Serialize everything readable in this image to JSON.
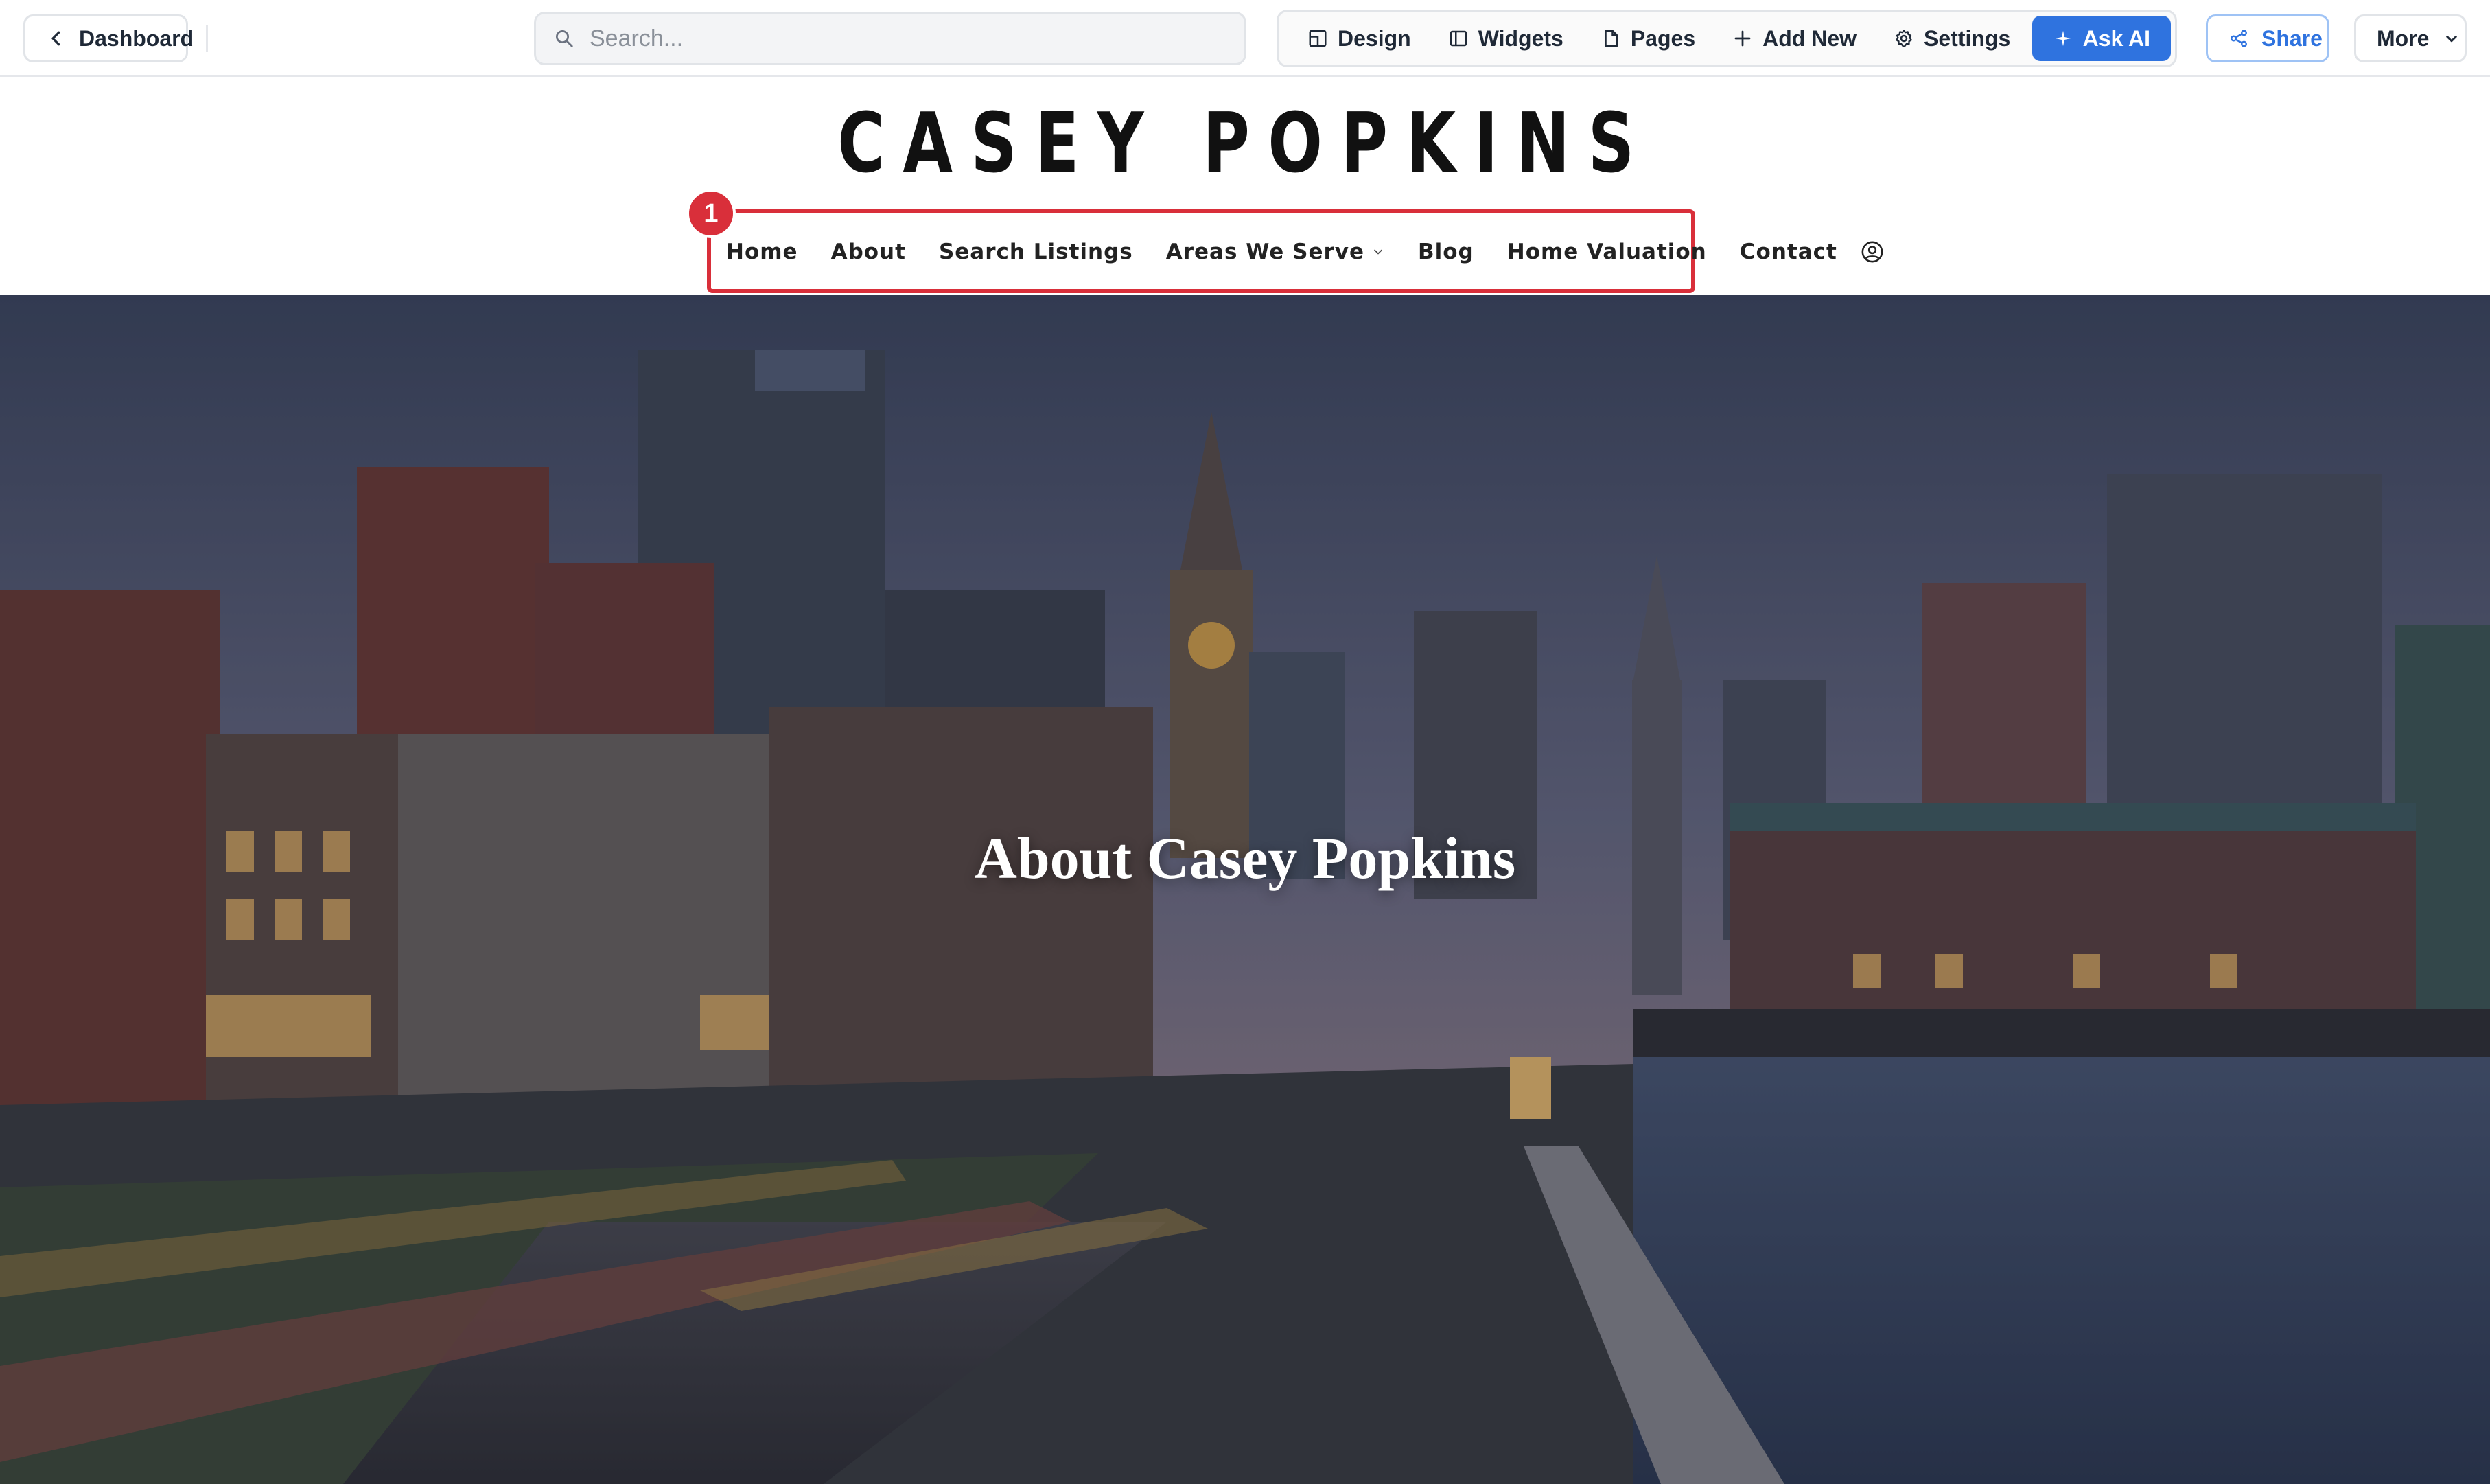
{
  "toolbar": {
    "dashboard_label": "Dashboard",
    "search_placeholder": "Search...",
    "tools": [
      {
        "label": "Design",
        "icon": "design-icon"
      },
      {
        "label": "Widgets",
        "icon": "widgets-icon"
      },
      {
        "label": "Pages",
        "icon": "page-icon"
      },
      {
        "label": "Add New",
        "icon": "plus-icon"
      },
      {
        "label": "Settings",
        "icon": "gear-icon"
      }
    ],
    "ask_ai_label": "Ask AI",
    "share_label": "Share",
    "more_label": "More"
  },
  "site": {
    "brand": "CASEY POPKINS",
    "nav": [
      "Home",
      "About",
      "Search Listings",
      "Areas We Serve",
      "Blog",
      "Home Valuation",
      "Contact"
    ],
    "annotation_number": "1"
  },
  "hero": {
    "title": "About Casey Popkins"
  },
  "colors": {
    "accent": "#2f73df",
    "annotation": "#d92f3a"
  }
}
